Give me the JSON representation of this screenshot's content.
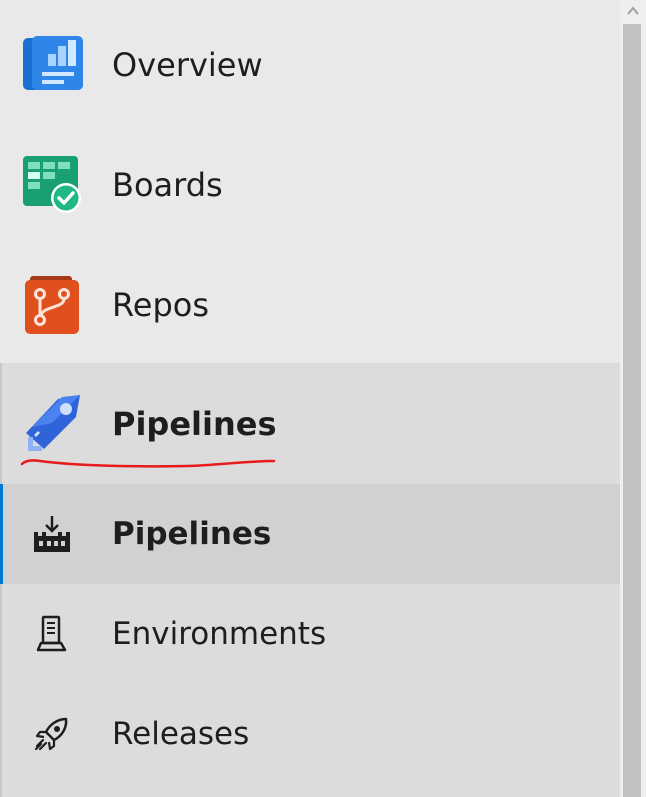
{
  "nav": {
    "items": [
      {
        "label": "Overview",
        "icon": "overview-icon"
      },
      {
        "label": "Boards",
        "icon": "boards-icon"
      },
      {
        "label": "Repos",
        "icon": "repos-icon"
      },
      {
        "label": "Pipelines",
        "icon": "pipelines-icon"
      }
    ],
    "subitems": [
      {
        "label": "Pipelines",
        "icon": "pipelines-sub-icon",
        "selected": true
      },
      {
        "label": "Environments",
        "icon": "environments-icon"
      },
      {
        "label": "Releases",
        "icon": "releases-icon"
      }
    ]
  },
  "colors": {
    "accent": "#0078d4",
    "annotation": "#e81c1c",
    "overview": "#1b6fd0",
    "boards": "#1a9f72",
    "repos": "#e0501f",
    "pipelines": "#2f63d8"
  }
}
